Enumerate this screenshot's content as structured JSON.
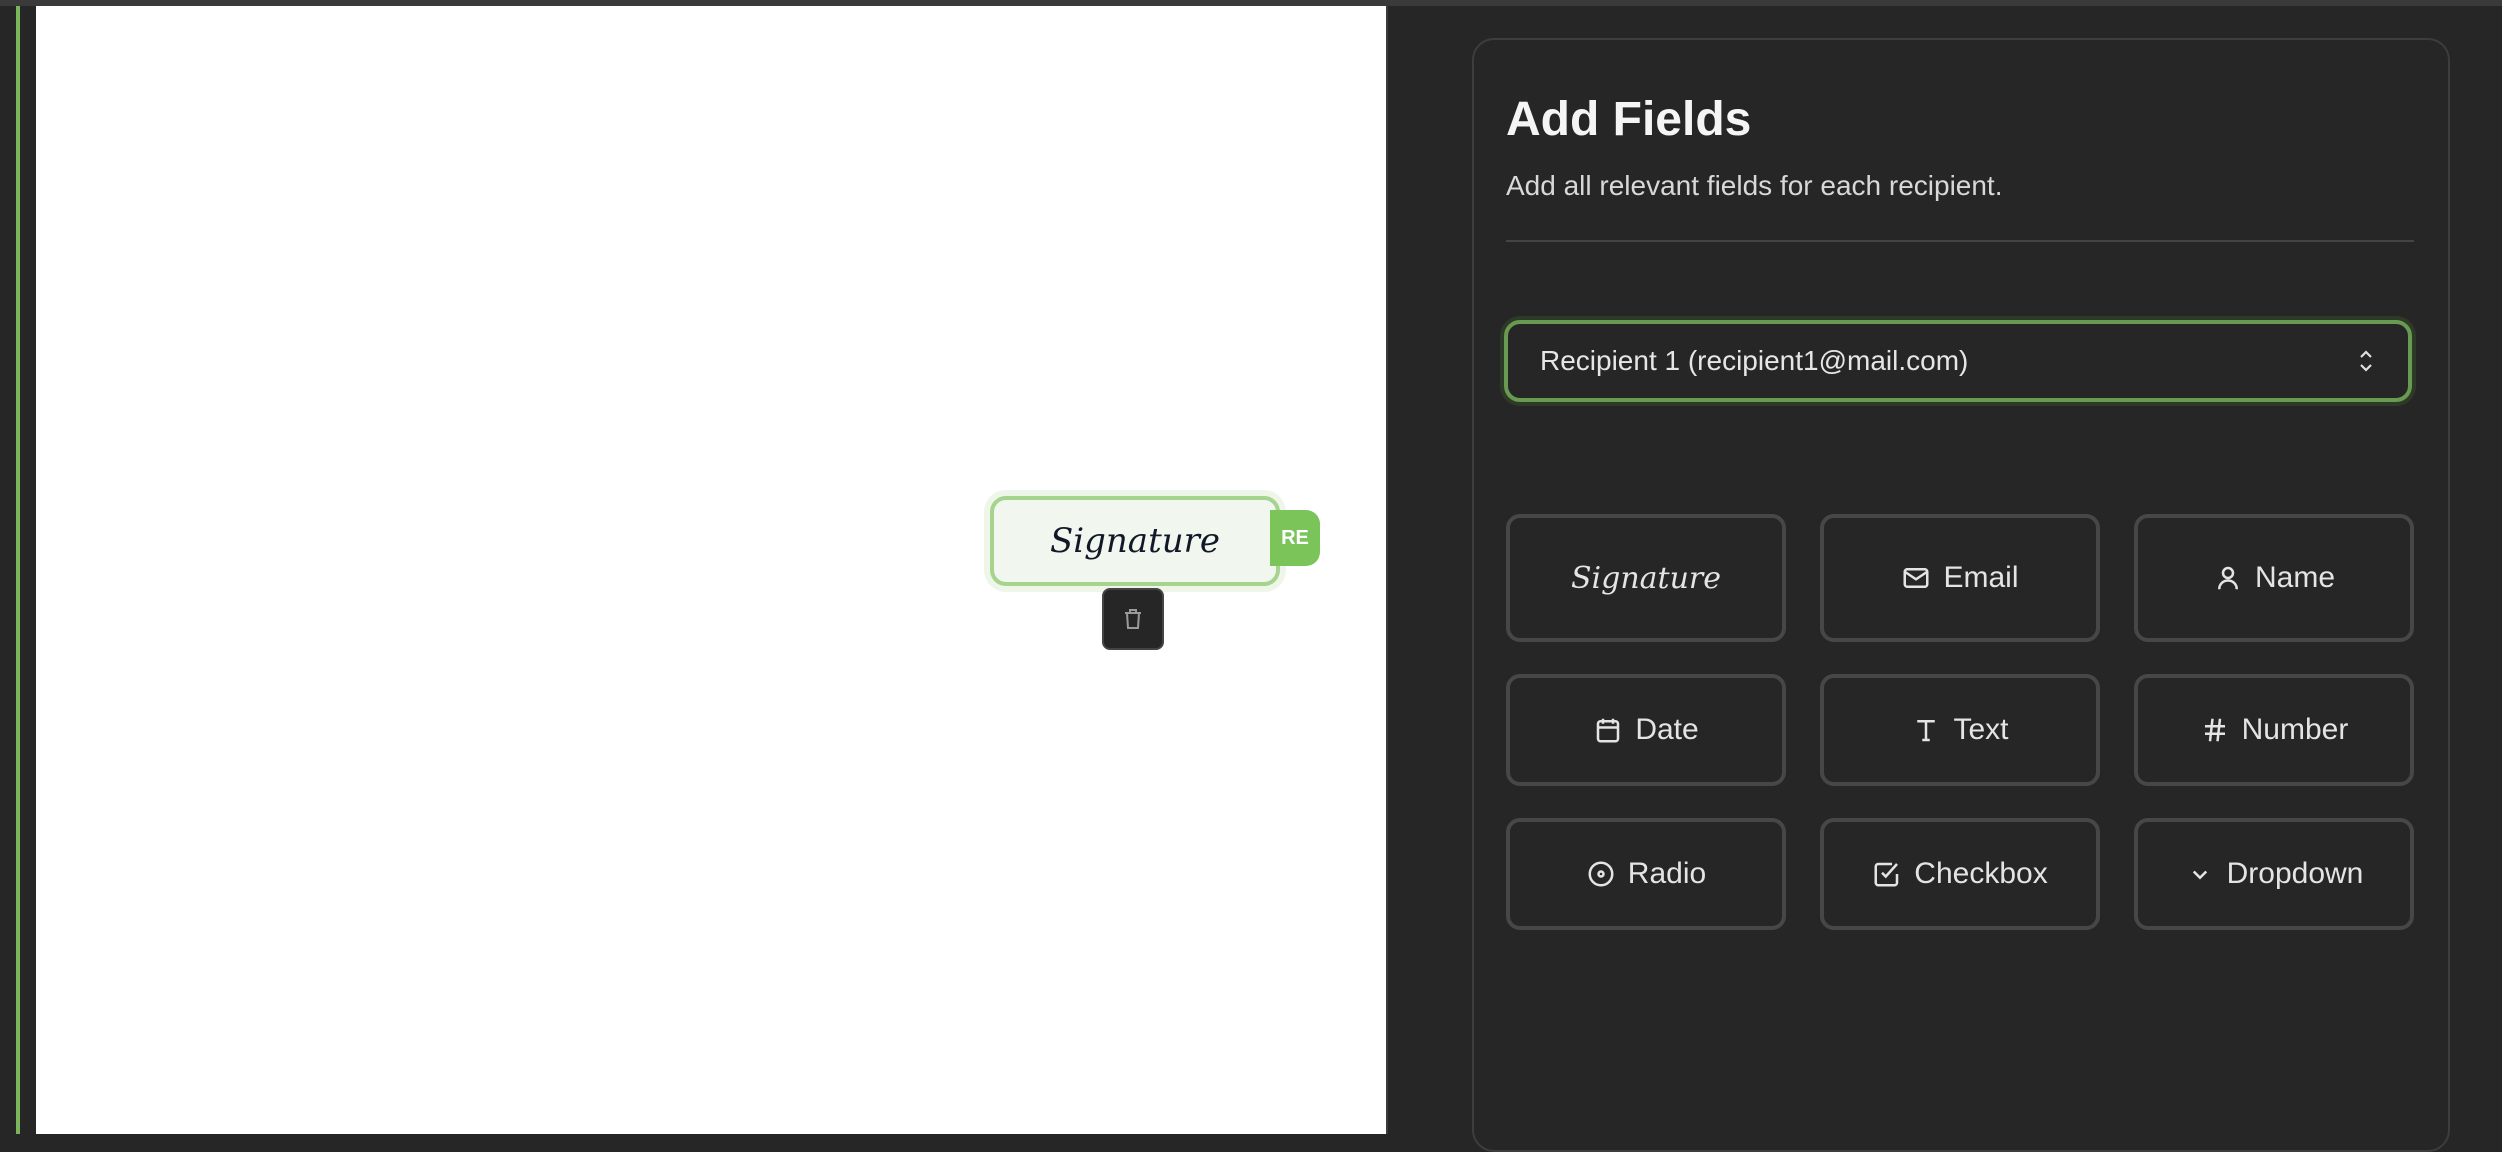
{
  "document": {
    "placed_field": {
      "label": "Signature",
      "recipient_badge": "RE"
    },
    "delete_icon": "trash-icon"
  },
  "panel": {
    "title": "Add Fields",
    "subtitle": "Add all relevant fields for each recipient.",
    "recipient_select": {
      "value": "Recipient 1 (recipient1@mail.com)",
      "icon": "chevrons-up-down-icon"
    },
    "field_types": [
      {
        "label": "Signature",
        "icon": "none"
      },
      {
        "label": "Email",
        "icon": "mail-icon"
      },
      {
        "label": "Name",
        "icon": "user-icon"
      },
      {
        "label": "Date",
        "icon": "calendar-icon"
      },
      {
        "label": "Text",
        "icon": "type-icon"
      },
      {
        "label": "Number",
        "icon": "hash-icon"
      },
      {
        "label": "Radio",
        "icon": "radio-icon"
      },
      {
        "label": "Checkbox",
        "icon": "checkbox-icon"
      },
      {
        "label": "Dropdown",
        "icon": "chevron-down-icon"
      }
    ]
  },
  "colors": {
    "accent": "#7ac45a",
    "field_bg": "#f1f7ee",
    "panel_bg": "#262626"
  }
}
